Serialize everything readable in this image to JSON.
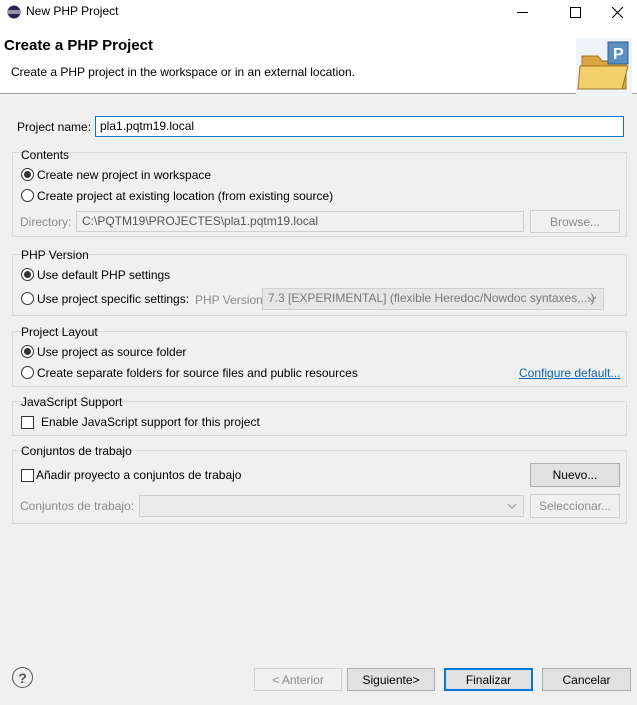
{
  "window": {
    "title": "New PHP Project",
    "minimize_glyph": "—",
    "maximize_glyph": "☐",
    "close_glyph": "✕"
  },
  "banner": {
    "title": "Create a PHP Project",
    "description": "Create a PHP project in the workspace or in an external location.",
    "image_letter": "P"
  },
  "project_name": {
    "label": "Project name:",
    "value": "pla1.pqtm19.local"
  },
  "contents": {
    "title": "Contents",
    "option_workspace": "Create new project in workspace",
    "option_existing": "Create project at existing location (from existing source)",
    "directory_label": "Directory:",
    "directory_value": "C:\\PQTM19\\PROJECTES\\pla1.pqtm19.local",
    "browse_label": "Browse..."
  },
  "php_version": {
    "title": "PHP Version",
    "option_default": "Use default PHP settings",
    "option_specific": "Use project specific settings:",
    "version_label": "PHP Version:",
    "version_value": "7.3 [EXPERIMENTAL] (flexible Heredoc/Nowdoc syntaxes,...)"
  },
  "project_layout": {
    "title": "Project Layout",
    "option_source": "Use project as source folder",
    "option_separate": "Create separate folders for source files and public resources",
    "configure_link": "Configure default..."
  },
  "javascript": {
    "title": "JavaScript Support",
    "option_enable": "Enable JavaScript support for this project"
  },
  "working_sets": {
    "title": "Conjuntos de trabajo",
    "option_add": "Añadir proyecto a conjuntos de trabajo",
    "new_button": "Nuevo...",
    "sets_label": "Conjuntos de trabajo:",
    "select_button": "Seleccionar..."
  },
  "footer": {
    "help_glyph": "?",
    "back_button": "< Anterior",
    "next_button": "Siguiente>",
    "finish_button": "Finalizar",
    "cancel_button": "Cancelar"
  },
  "colors": {
    "accent": "#0078d7",
    "link": "#0b62b4",
    "dialog_bg": "#f0f0f0"
  }
}
